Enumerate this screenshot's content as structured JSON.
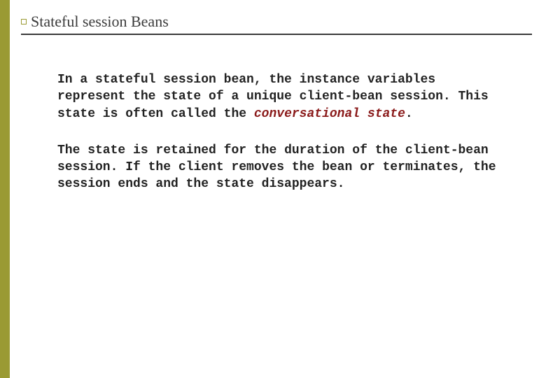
{
  "title": "Stateful session Beans",
  "paragraph1": {
    "t1": "In a stateful session bean, the instance variables represent the state of a unique client-bean session. This state is often called the ",
    "emph": "conversational state",
    "t2": "."
  },
  "paragraph2": {
    "t1": "The state is ",
    "bold1": "retained for the duration of the client-bean session",
    "t2": ". If the client removes the bean or terminates, the session ends and the state disappears."
  }
}
